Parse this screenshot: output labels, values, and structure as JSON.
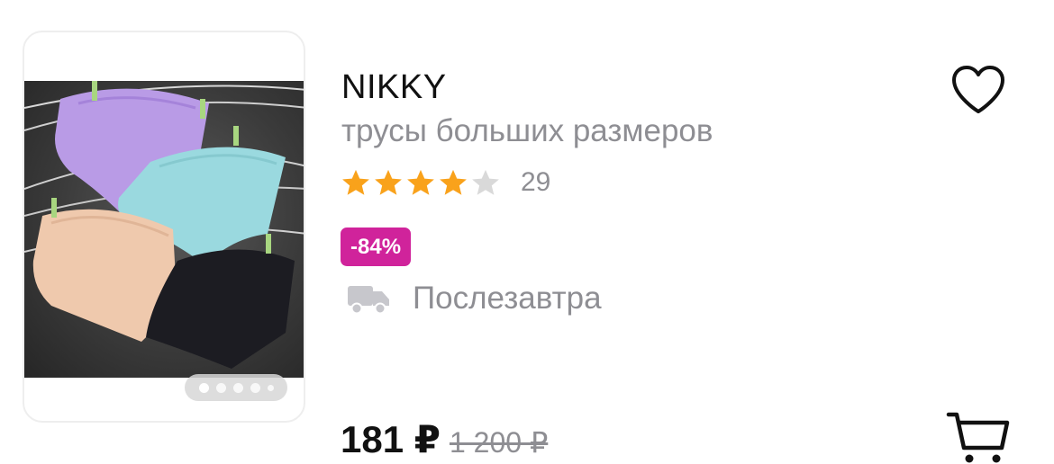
{
  "product": {
    "brand": "NIKKY",
    "title": "трусы больших размеров",
    "rating": 4,
    "rating_max": 5,
    "rating_count": "29",
    "discount_badge": "-84%",
    "delivery": "Послезавтра",
    "price_current": "181 ₽",
    "price_old": "1 200 ₽"
  },
  "gallery": {
    "image_count": 5,
    "active_index": 0
  },
  "icons": {
    "favorite": "heart-outline-icon",
    "cart": "cart-icon",
    "delivery": "truck-icon",
    "star": "star-icon"
  },
  "colors": {
    "star_filled": "#f9a21b",
    "star_empty": "#d9d9d9",
    "badge": "#d0239b",
    "muted_text": "#8e8e93"
  }
}
